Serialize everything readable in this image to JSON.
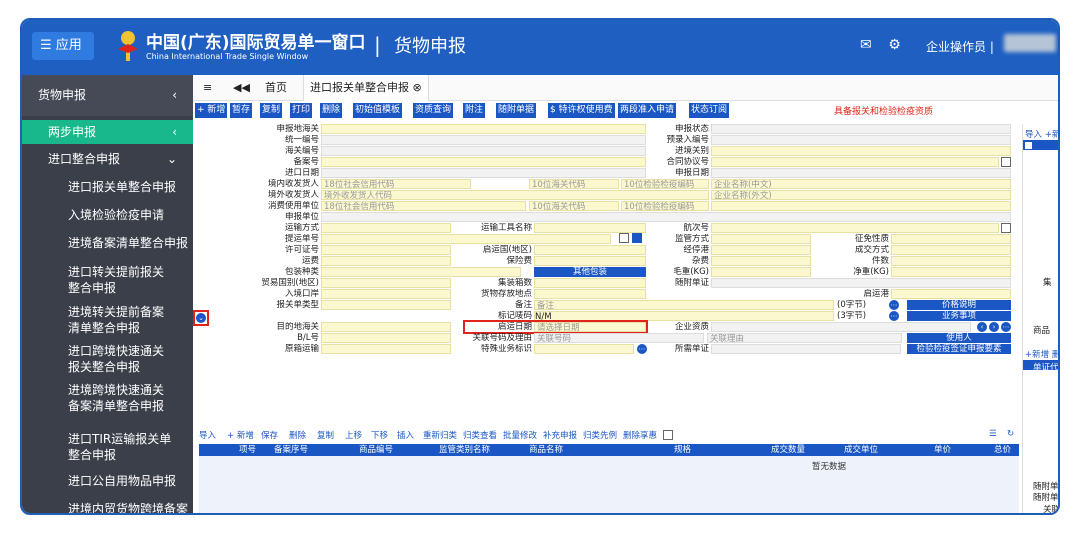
{
  "header": {
    "app_label": "☰  应用",
    "brand": "中国(广东)国际贸易单一窗口",
    "brand_sub": "China International Trade Single Window",
    "separator": "|",
    "module": "货物申报",
    "user": "企业操作员 |"
  },
  "sidebar": {
    "title": "货物申报",
    "items": [
      {
        "label": "两步申报"
      },
      {
        "label": "进口整合申报"
      },
      {
        "label": "进口报关单整合申报"
      },
      {
        "label": "入境检验检疫申请"
      },
      {
        "label": "进境备案清单整合申报"
      },
      {
        "label": "进口转关提前报关整合申报"
      },
      {
        "label": "进境转关提前备案清单整合申报"
      },
      {
        "label": "进口跨境快速通关报关整合申报"
      },
      {
        "label": "进境跨境快速通关备案清单整合申报"
      },
      {
        "label": "进口TIR运输报关单整合申报"
      },
      {
        "label": "进口公自用物品申报"
      },
      {
        "label": "进境内贸货物跨境备案"
      }
    ]
  },
  "tabs": {
    "menu": "≡",
    "back": "◀◀",
    "home": "首页",
    "active": "进口报关单整合申报 ⊗"
  },
  "toolbar": {
    "buttons": [
      "+ 新增",
      "暂存",
      "复制",
      "打印",
      "删除",
      "初始值模板",
      "资质查询",
      "附注",
      "随附单据",
      "$ 特许权使用费",
      "两段准入申请",
      "状态订阅"
    ],
    "warning": "具备报关和检验检疫资质"
  },
  "form": {
    "labels": {
      "l1": "申报地海关",
      "l2": "统一编号",
      "l3": "海关编号",
      "l4": "备案号",
      "l5": "进口日期",
      "l6": "境内收发货人",
      "l7": "境外收发货人",
      "l8": "消费使用单位",
      "l9": "申报单位",
      "l10": "运输方式",
      "l11": "提运单号",
      "l12": "许可证号",
      "l13": "运费",
      "l14": "包装种类",
      "l15": "贸易国别(地区)",
      "l16": "入境口岸",
      "l17": "报关单类型",
      "l18": "目的地海关",
      "l19": "B/L号",
      "l20": "原箱运输",
      "m1": "运输工具名称",
      "m2": "启运国(地区)",
      "m3": "保险费",
      "m4": "集装箱数",
      "m5": "货物存放地点",
      "m6": "备注",
      "m7": "标记唛码",
      "m8": "启运日期",
      "m9": "关联号码及理由",
      "m10": "特殊业务标识",
      "r1": "申报状态",
      "r2": "预录入编号",
      "r3": "进境关别",
      "r4": "合同协议号",
      "r5": "申报日期",
      "r6": "航次号",
      "r7": "监管方式",
      "r8": "经停港",
      "r9": "杂费",
      "r10": "毛重(KG)",
      "r11": "随附单证",
      "r12": "企业资质",
      "r13": "所需单证",
      "x1": "征免性质",
      "x2": "成交方式",
      "x3": "件数",
      "x4": "净重(KG)",
      "x5": "启运港"
    },
    "placeholders": {
      "p1": "18位社会信用代码",
      "p2": "10位海关代码",
      "p3": "10位检验检疫编码",
      "p4": "企业名称(中文)",
      "p5": "境外收发货人代码",
      "p6": "企业名称(外文)",
      "p7": "18位社会信用代码",
      "p8": "10位海关代码",
      "p9": "10位检验检疫编码",
      "p10": "请选择日期",
      "p11": "关联号码",
      "p12": "关联理由",
      "p13": "备注"
    },
    "values": {
      "mark": "N/M",
      "bytes0": "(0字节)",
      "bytes3": "(3字节)"
    },
    "buttons": {
      "other_pack": "其他包装",
      "price": "价格说明",
      "business": "业务事项",
      "user": "使用人",
      "cert": "检验检疫签证申报要素"
    }
  },
  "grid": {
    "toolbar": [
      "导入",
      "+ 新增",
      "保存",
      "删除",
      "复制",
      "上移",
      "下移",
      "插入",
      "重新归类",
      "归类查看",
      "批量修改",
      "补充申报",
      "归类先例",
      "删除享惠"
    ],
    "columns": [
      "项号",
      "备案序号",
      "商品编号",
      "监管类别名称",
      "商品名称",
      "规格",
      "成交数量",
      "成交单位",
      "单价",
      "总价"
    ],
    "empty": "暂无数据"
  },
  "right_panel": {
    "top": "导入 +新",
    "mid": "+新增 删",
    "cert": "单证代码",
    "bottom": [
      "随附单",
      "随附单",
      "关联"
    ],
    "misc": [
      "集",
      "商品"
    ]
  }
}
